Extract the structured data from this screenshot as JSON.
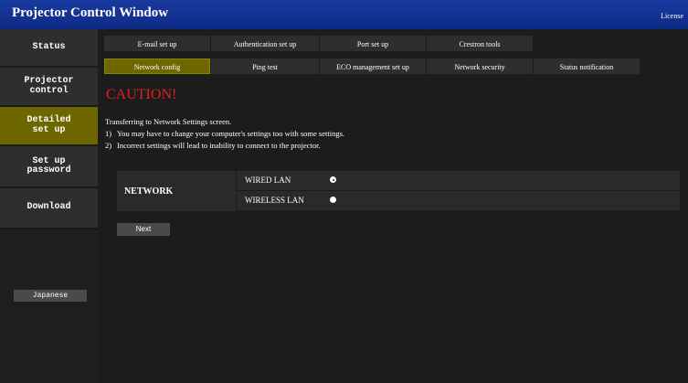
{
  "header": {
    "title": "Projector Control Window",
    "license": "License"
  },
  "sidebar": {
    "items": [
      {
        "label": "Status"
      },
      {
        "label": "Projector\ncontrol"
      },
      {
        "label": "Detailed\nset up"
      },
      {
        "label": "Set up\npassword"
      },
      {
        "label": "Download"
      }
    ],
    "language_button": "Japanese"
  },
  "tabs": {
    "row1": [
      "E-mail set up",
      "Authentication set up",
      "Port set up",
      "Crestron tools"
    ],
    "row2": [
      "Network config",
      "Ping test",
      "ECO management set up",
      "Network security",
      "Status notification"
    ]
  },
  "content": {
    "caution": "CAUTION!",
    "intro": "Transferring to Network Settings screen.",
    "notes": [
      {
        "num": "1)",
        "text": "You may have to change your computer's settings too with some settings."
      },
      {
        "num": "2)",
        "text": "Incorrect settings will lead to inability to connect to the projector."
      }
    ],
    "network_label": "NETWORK",
    "options": [
      {
        "label": "WIRED LAN",
        "selected": true
      },
      {
        "label": "WIRELESS LAN",
        "selected": false
      }
    ],
    "next_button": "Next"
  },
  "colors": {
    "header": "#1a3aa0",
    "active": "#6e6700",
    "caution": "#e02020"
  }
}
